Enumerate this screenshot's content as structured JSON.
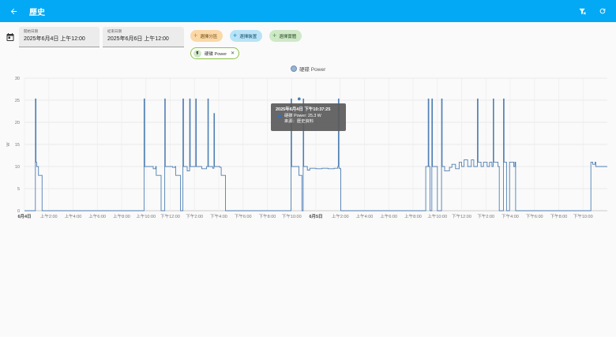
{
  "appbar": {
    "title": "歷史",
    "back_icon": "arrow-left-icon",
    "filter_clear_icon": "filter-remove-icon",
    "refresh_icon": "refresh-icon"
  },
  "filters": {
    "start": {
      "label": "開始日期",
      "value": "2025年6月4日 上午12:00"
    },
    "end": {
      "label": "結束日期",
      "value": "2025年6月6日 上午12:00"
    },
    "chips": {
      "area": "選擇分區",
      "device": "選擇裝置",
      "entity": "選擇實體"
    },
    "selected_entity": "硬碟 Power"
  },
  "legend": {
    "label": "硬碟 Power",
    "color": "#4f7fb4"
  },
  "tooltip": {
    "title": "2025年6月4日 下午10:37:25",
    "value": "硬碟 Power: 25.3 W",
    "source": "來源：歷史資料"
  },
  "chart_data": {
    "type": "line",
    "ylabel": "W",
    "ylim": [
      0,
      30
    ],
    "yticks": [
      0,
      5,
      10,
      15,
      20,
      25,
      30
    ],
    "xlim": [
      0,
      48
    ],
    "xticks": [
      {
        "x": 0,
        "label": "6月4日",
        "bold": true
      },
      {
        "x": 2,
        "label": "上午2:00"
      },
      {
        "x": 4,
        "label": "上午4:00"
      },
      {
        "x": 6,
        "label": "上午6:00"
      },
      {
        "x": 8,
        "label": "上午8:00"
      },
      {
        "x": 10,
        "label": "上午10:00"
      },
      {
        "x": 12,
        "label": "下午12:00"
      },
      {
        "x": 14,
        "label": "下午2:00"
      },
      {
        "x": 16,
        "label": "下午4:00"
      },
      {
        "x": 18,
        "label": "下午6:00"
      },
      {
        "x": 20,
        "label": "下午8:00"
      },
      {
        "x": 22,
        "label": "下午10:00"
      },
      {
        "x": 24,
        "label": "6月5日",
        "bold": true
      },
      {
        "x": 26,
        "label": "上午2:00"
      },
      {
        "x": 28,
        "label": "上午4:00"
      },
      {
        "x": 30,
        "label": "上午6:00"
      },
      {
        "x": 32,
        "label": "上午8:00"
      },
      {
        "x": 34,
        "label": "上午10:00"
      },
      {
        "x": 36,
        "label": "下午12:00"
      },
      {
        "x": 38,
        "label": "下午2:00"
      },
      {
        "x": 40,
        "label": "下午4:00"
      },
      {
        "x": 42,
        "label": "下午6:00"
      },
      {
        "x": 44,
        "label": "下午8:00"
      },
      {
        "x": 46,
        "label": "下午10:00"
      }
    ],
    "series": [
      {
        "name": "硬碟 Power",
        "points": [
          [
            0,
            0
          ],
          [
            0.85,
            0
          ],
          [
            0.9,
            25.3
          ],
          [
            0.95,
            11
          ],
          [
            1.0,
            10
          ],
          [
            1.1,
            10
          ],
          [
            1.15,
            8
          ],
          [
            1.4,
            8
          ],
          [
            1.45,
            0
          ],
          [
            9.8,
            0
          ],
          [
            9.85,
            25.3
          ],
          [
            9.9,
            10
          ],
          [
            10.6,
            9.5
          ],
          [
            10.8,
            10
          ],
          [
            10.85,
            8
          ],
          [
            11.2,
            8
          ],
          [
            11.25,
            0
          ],
          [
            11.5,
            0
          ],
          [
            11.55,
            25.3
          ],
          [
            11.6,
            10
          ],
          [
            12.2,
            9.8
          ],
          [
            12.4,
            10
          ],
          [
            12.45,
            8
          ],
          [
            12.8,
            8
          ],
          [
            12.85,
            0
          ],
          [
            13.0,
            0
          ],
          [
            13.05,
            25.3
          ],
          [
            13.1,
            10
          ],
          [
            13.4,
            9
          ],
          [
            13.6,
            25.3
          ],
          [
            13.65,
            10
          ],
          [
            14.0,
            10
          ],
          [
            14.1,
            25.3
          ],
          [
            14.15,
            10
          ],
          [
            14.6,
            9.5
          ],
          [
            15.0,
            10
          ],
          [
            15.1,
            25.3
          ],
          [
            15.15,
            10
          ],
          [
            15.5,
            9.6
          ],
          [
            15.6,
            22
          ],
          [
            15.65,
            10
          ],
          [
            16.1,
            9.8
          ],
          [
            16.2,
            8
          ],
          [
            16.5,
            8
          ],
          [
            16.55,
            0
          ],
          [
            21.9,
            0
          ],
          [
            21.95,
            25.3
          ],
          [
            22.0,
            10
          ],
          [
            22.5,
            10
          ],
          [
            22.6,
            8
          ],
          [
            22.8,
            8
          ],
          [
            22.85,
            0
          ],
          [
            22.9,
            0
          ],
          [
            22.95,
            25.3
          ],
          [
            23.0,
            10
          ],
          [
            23.3,
            9.2
          ],
          [
            23.5,
            9.6
          ],
          [
            24.0,
            9.5
          ],
          [
            24.5,
            9.6
          ],
          [
            25.0,
            9.5
          ],
          [
            25.5,
            9.6
          ],
          [
            25.8,
            10
          ],
          [
            25.85,
            25.3
          ],
          [
            25.9,
            9.6
          ],
          [
            26.0,
            9.5
          ],
          [
            26.05,
            0
          ],
          [
            33.0,
            0
          ],
          [
            33.05,
            10
          ],
          [
            33.2,
            10
          ],
          [
            33.25,
            25.3
          ],
          [
            33.3,
            10
          ],
          [
            33.4,
            0
          ],
          [
            33.5,
            0
          ],
          [
            33.55,
            25.3
          ],
          [
            33.6,
            10
          ],
          [
            33.9,
            10
          ],
          [
            34.0,
            0
          ],
          [
            34.3,
            0
          ],
          [
            34.35,
            25.3
          ],
          [
            34.4,
            10
          ],
          [
            34.6,
            9
          ],
          [
            35.0,
            9.8
          ],
          [
            35.2,
            10.5
          ],
          [
            35.5,
            9.5
          ],
          [
            35.8,
            11
          ],
          [
            36.0,
            10
          ],
          [
            36.2,
            11.5
          ],
          [
            36.5,
            10
          ],
          [
            36.8,
            11.5
          ],
          [
            37.0,
            10
          ],
          [
            37.3,
            25.3
          ],
          [
            37.35,
            11
          ],
          [
            37.6,
            10
          ],
          [
            37.8,
            11
          ],
          [
            38.1,
            10
          ],
          [
            38.3,
            11
          ],
          [
            38.5,
            10
          ],
          [
            38.6,
            25.3
          ],
          [
            38.65,
            11
          ],
          [
            39.0,
            10
          ],
          [
            39.1,
            0
          ],
          [
            39.4,
            0
          ],
          [
            39.45,
            25.3
          ],
          [
            39.5,
            11
          ],
          [
            39.7,
            0
          ],
          [
            39.9,
            0
          ],
          [
            39.95,
            11
          ],
          [
            40.3,
            10
          ],
          [
            40.4,
            11
          ],
          [
            40.45,
            0
          ],
          [
            46.6,
            0
          ],
          [
            46.65,
            11
          ],
          [
            46.8,
            10.5
          ],
          [
            47.0,
            11
          ],
          [
            47.05,
            10
          ],
          [
            48,
            10
          ]
        ]
      }
    ],
    "highlight": {
      "x": 22.62,
      "y": 25.3
    }
  }
}
